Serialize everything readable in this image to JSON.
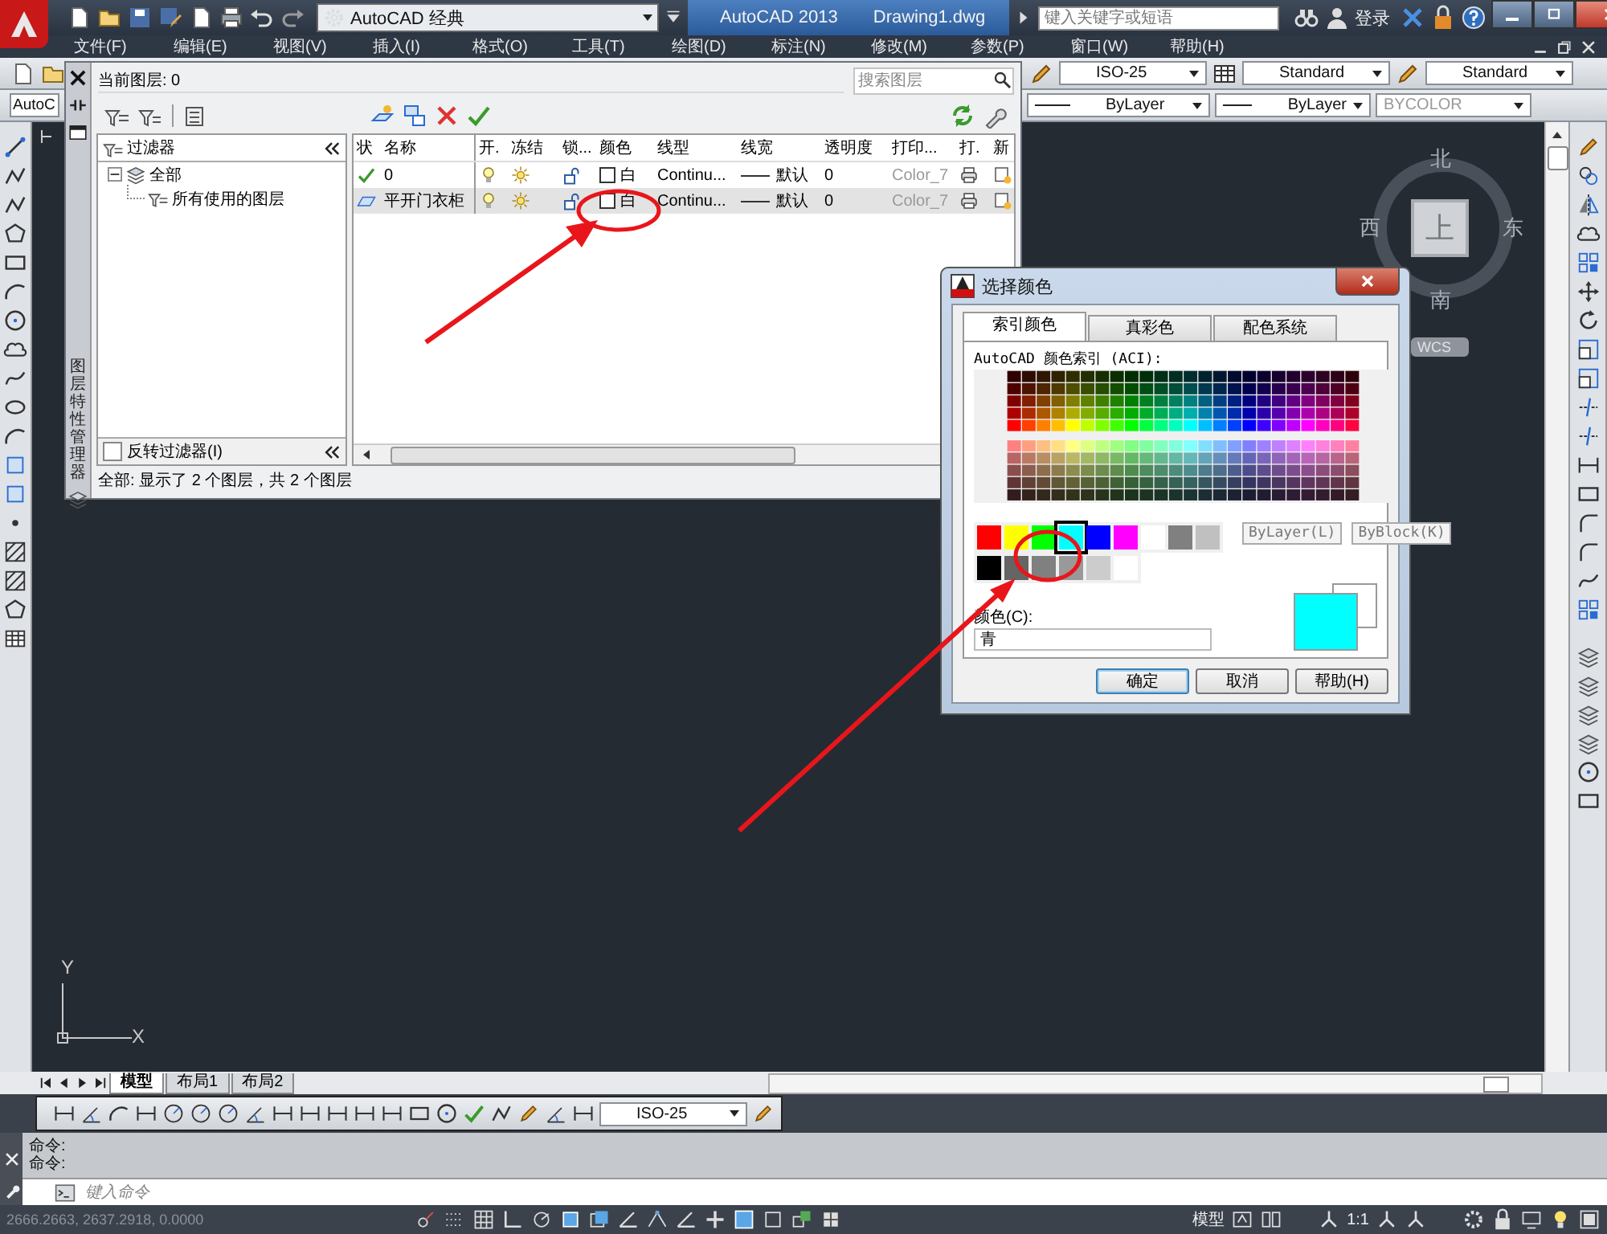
{
  "title_bar": {
    "workspace": "AutoCAD 经典",
    "app": "AutoCAD 2013",
    "document": "Drawing1.dwg",
    "search": {
      "placeholder": "键入关键字或短语"
    },
    "login": "登录"
  },
  "menu": [
    "文件(F)",
    "编辑(E)",
    "视图(V)",
    "插入(I)",
    "格式(O)",
    "工具(T)",
    "绘图(D)",
    "标注(N)",
    "修改(M)",
    "参数(P)",
    "窗口(W)",
    "帮助(H)"
  ],
  "style_toolbar": {
    "dim_style": "ISO-25",
    "table_style": "Standard",
    "multileader_style": "Standard"
  },
  "properties_toolbar": {
    "workspace_combo": "AutoC",
    "linetype": "ByLayer",
    "lineweight": "ByLayer",
    "plot_style": "BYCOLOR"
  },
  "layer_manager": {
    "side_title": "图层特性管理器",
    "current_layer": "当前图层: 0",
    "search": {
      "placeholder": "搜索图层"
    },
    "filters": {
      "title": "过滤器",
      "tree": [
        {
          "label": "全部",
          "expanded": true,
          "children": [
            {
              "label": "所有使用的图层"
            }
          ]
        }
      ],
      "invert": {
        "label": "反转过滤器(I)",
        "checked": false
      }
    },
    "columns": [
      "状",
      "名称",
      "开.",
      "冻结",
      "锁...",
      "颜色",
      "线型",
      "线宽",
      "透明度",
      "打印...",
      "打.",
      "新"
    ],
    "layers": [
      {
        "current": true,
        "name": "0",
        "on": true,
        "frozen": false,
        "locked": false,
        "color": "#ffffff",
        "color_name": "白",
        "linetype": "Continu...",
        "lineweight": "默认",
        "transparency": "0",
        "plot_style": "Color_7",
        "selected": false
      },
      {
        "current": false,
        "name": "平开门衣柜",
        "on": true,
        "frozen": false,
        "locked": false,
        "color": "#ffffff",
        "color_name": "白",
        "linetype": "Continu...",
        "lineweight": "默认",
        "transparency": "0",
        "plot_style": "Color_7",
        "selected": true
      }
    ],
    "status": "全部: 显示了 2 个图层，共 2 个图层"
  },
  "color_dialog": {
    "title": "选择颜色",
    "tabs": [
      {
        "label": "索引颜色",
        "selected": true
      },
      {
        "label": "真彩色",
        "selected": false
      },
      {
        "label": "配色系统",
        "selected": false
      }
    ],
    "aci_label": "AutoCAD 颜色索引 (ACI):",
    "standard_colors": [
      {
        "color": "#ff0000",
        "selected": false
      },
      {
        "color": "#ffff00",
        "selected": false
      },
      {
        "color": "#00ff00",
        "selected": false
      },
      {
        "color": "#00ffff",
        "selected": true
      },
      {
        "color": "#0000ff",
        "selected": false
      },
      {
        "color": "#ff00ff",
        "selected": false
      },
      {
        "color": "#ffffff",
        "selected": false
      },
      {
        "color": "#808080",
        "selected": false
      },
      {
        "color": "#c0c0c0",
        "selected": false
      }
    ],
    "gray_colors": [
      {
        "color": "#000000",
        "selected": false
      },
      {
        "color": "#656565",
        "selected": false
      },
      {
        "color": "#808080",
        "selected": false
      },
      {
        "color": "#999999",
        "selected": false
      },
      {
        "color": "#cccccc",
        "selected": false
      },
      {
        "color": "#ffffff",
        "selected": false
      }
    ],
    "bylayer": "ByLayer(L)",
    "byblock": "ByBlock(K)",
    "color_label": "颜色(C):",
    "color_value": "青",
    "buttons": [
      "确定",
      "取消",
      "帮助(H)"
    ]
  },
  "viewcube": {
    "north": "北",
    "south": "南",
    "west": "西",
    "east": "东",
    "face": "上",
    "ucs": "WCS"
  },
  "ucs_icon": {
    "y": "Y",
    "x": "X"
  },
  "layout_tabs": [
    {
      "label": "模型",
      "selected": true
    },
    {
      "label": "布局1",
      "selected": false
    },
    {
      "label": "布局2",
      "selected": false
    }
  ],
  "dim_toolbar": {
    "style": "ISO-25"
  },
  "command_line": {
    "history": [
      "命令:",
      "命令:"
    ],
    "placeholder": "键入命令"
  },
  "status_bar": {
    "coordinates": "2666.2663, 2637.2918, 0.0000",
    "space": "模型",
    "scale": "1:1"
  }
}
